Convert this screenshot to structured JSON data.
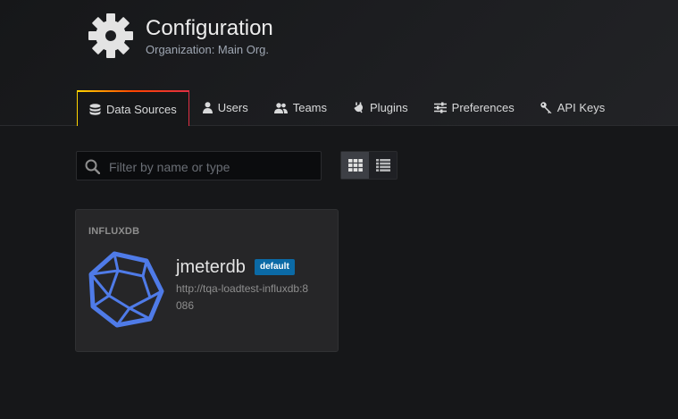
{
  "header": {
    "title": "Configuration",
    "subtitle": "Organization: Main Org.",
    "icon": "gear-icon"
  },
  "tabs": [
    {
      "label": "Data Sources",
      "icon": "database-icon",
      "active": true
    },
    {
      "label": "Users",
      "icon": "user-icon",
      "active": false
    },
    {
      "label": "Teams",
      "icon": "users-icon",
      "active": false
    },
    {
      "label": "Plugins",
      "icon": "plug-icon",
      "active": false
    },
    {
      "label": "Preferences",
      "icon": "sliders-icon",
      "active": false
    },
    {
      "label": "API Keys",
      "icon": "key-icon",
      "active": false
    }
  ],
  "search": {
    "placeholder": "Filter by name or type",
    "value": ""
  },
  "view_toggle": {
    "selected": "grid",
    "options": [
      "grid",
      "list"
    ]
  },
  "datasources": [
    {
      "type": "INFLUXDB",
      "name": "jmeterdb",
      "badge": "default",
      "url": "http://tqa-loadtest-influxdb:8086",
      "logo": "influxdb-logo-icon"
    }
  ],
  "colors": {
    "accent_gradient": [
      "#ffd500",
      "#ff4400",
      "#e02f44"
    ],
    "badge": "#0b6aa6",
    "influx_blue": "#4f7be8"
  }
}
